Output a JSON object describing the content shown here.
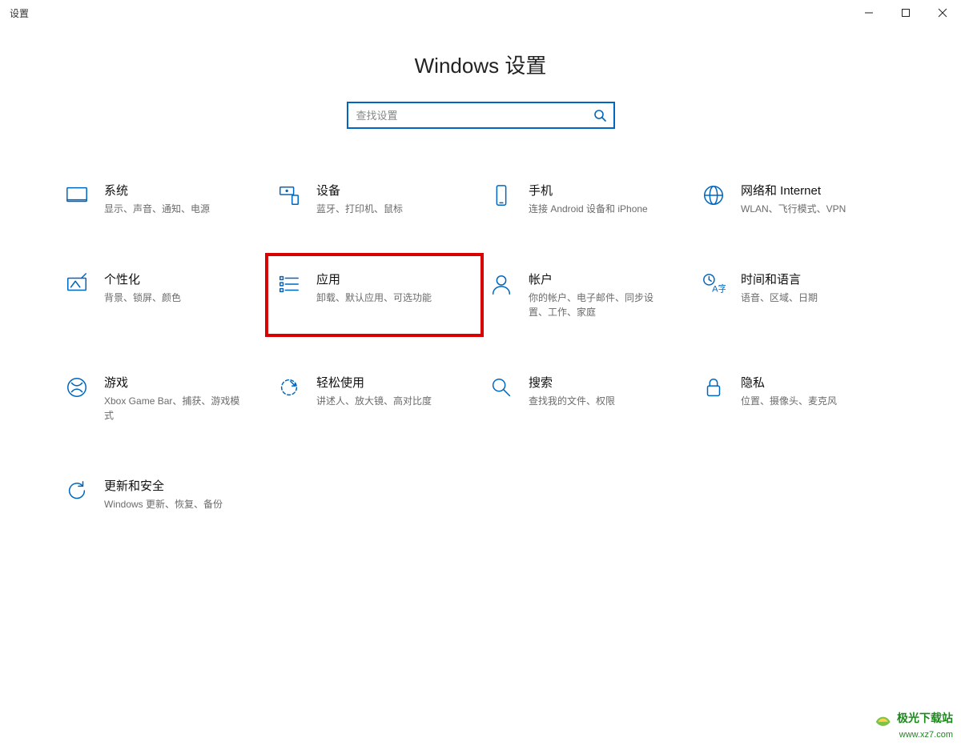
{
  "window": {
    "title": "设置"
  },
  "header": {
    "title": "Windows 设置"
  },
  "search": {
    "placeholder": "查找设置"
  },
  "tiles": [
    {
      "key": "system",
      "title": "系统",
      "desc": "显示、声音、通知、电源"
    },
    {
      "key": "devices",
      "title": "设备",
      "desc": "蓝牙、打印机、鼠标"
    },
    {
      "key": "phone",
      "title": "手机",
      "desc": "连接 Android 设备和 iPhone"
    },
    {
      "key": "network",
      "title": "网络和 Internet",
      "desc": "WLAN、飞行模式、VPN"
    },
    {
      "key": "personal",
      "title": "个性化",
      "desc": "背景、锁屏、颜色"
    },
    {
      "key": "apps",
      "title": "应用",
      "desc": "卸载、默认应用、可选功能",
      "highlight": true
    },
    {
      "key": "accounts",
      "title": "帐户",
      "desc": "你的帐户、电子邮件、同步设置、工作、家庭"
    },
    {
      "key": "time",
      "title": "时间和语言",
      "desc": "语音、区域、日期"
    },
    {
      "key": "gaming",
      "title": "游戏",
      "desc": "Xbox Game Bar、捕获、游戏模式"
    },
    {
      "key": "ease",
      "title": "轻松使用",
      "desc": "讲述人、放大镜、高对比度"
    },
    {
      "key": "search",
      "title": "搜索",
      "desc": "查找我的文件、权限"
    },
    {
      "key": "privacy",
      "title": "隐私",
      "desc": "位置、摄像头、麦克风"
    },
    {
      "key": "update",
      "title": "更新和安全",
      "desc": "Windows 更新、恢复、备份"
    }
  ],
  "watermark": {
    "line1": "极光下载站",
    "line2": "www.xz7.com"
  }
}
